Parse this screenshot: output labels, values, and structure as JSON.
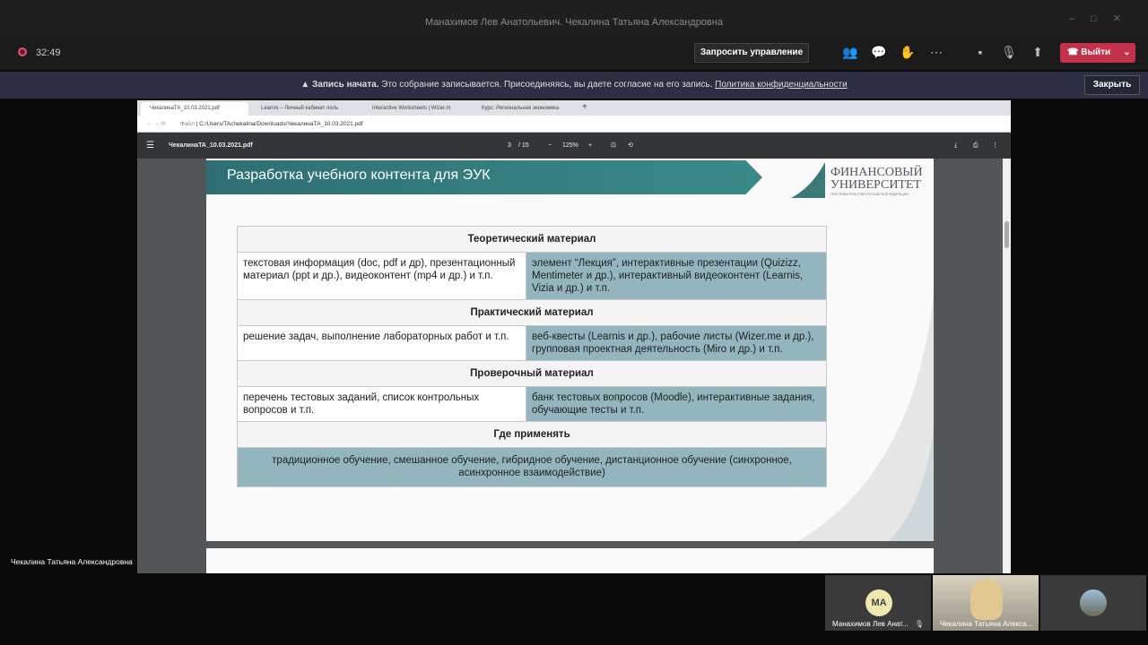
{
  "window_title": "Манахимов Лев Анатольевич. Чекалина Татьяна Александровна",
  "call": {
    "timer": "32:49",
    "request_control": "Запросить управление",
    "leave": "Выйти"
  },
  "banner": {
    "bold": "Запись начата.",
    "text": "Это собрание записывается. Присоединяясь, вы даете согласие на его запись.",
    "link": "Политика конфиденциальности",
    "close": "Закрыть"
  },
  "browser": {
    "tabs": [
      "ЧекалинаТА_10.03.2021.pdf",
      "Learnis – Личный кабинет поль",
      "Interactive Worksheets | Wizer.m",
      "Курс: Региональная экономика"
    ],
    "address_prefix": "Файл",
    "address": "C:/Users/TAchekalina/Downloads/ЧекалинаТА_10.03.2021.pdf",
    "pdf": {
      "filename": "ЧекалинаТА_10.03.2021.pdf",
      "page": "3",
      "total": "/ 15",
      "zoom": "125%"
    }
  },
  "slide": {
    "title": "Разработка учебного контента для ЭУК",
    "logo": [
      "ФИНАНСОВЫЙ",
      "УНИВЕРСИТЕТ",
      "ПРИ ПРАВИТЕЛЬСТВЕ РОССИЙСКОЙ ФЕДЕРАЦИИ"
    ],
    "sections": [
      {
        "header": "Теоретический материал",
        "left": "текстовая информация (doc, pdf и др), презентационный материал (ppt и др.), видеоконтент (mp4 и др.) и т.п.",
        "right": "элемент “Лекция”, интерактивные презентации (Quizizz, Mentimeter и др.), интерактивный видеоконтент (Learnis, Vizia и др.) и т.п."
      },
      {
        "header": "Практический материал",
        "left": "решение задач, выполнение лабораторных работ и т.п.",
        "right": "веб-квесты (Learnis и др.), рабочие листы (Wizer.me и др.), групповая проектная деятельность (Miro и др.) и т.п."
      },
      {
        "header": "Проверочный материал",
        "left": "перечень тестовых заданий, список контрольных вопросов и т.п.",
        "right": "банк тестовых вопросов (Moodle), интерактивные задания, обучающие тесты и т.п."
      }
    ],
    "where_header": "Где применять",
    "where_text": "традиционное обучение, смешанное обучение, гибридное обучение, дистанционное обучение (синхронное, асинхронное взаимодействие)"
  },
  "participants": {
    "self_name": "Чекалина Татьяна Александровна",
    "tiles": [
      {
        "initials": "MA",
        "name": "Манахимов Лев Анат..."
      },
      {
        "name": "Чекалина Татьяна Алекса..."
      }
    ]
  },
  "colors": {
    "leave": "#c4314b",
    "banner": "#2d2d44",
    "cell": "#93b5bd",
    "slide_banner": "#2e6f73"
  }
}
